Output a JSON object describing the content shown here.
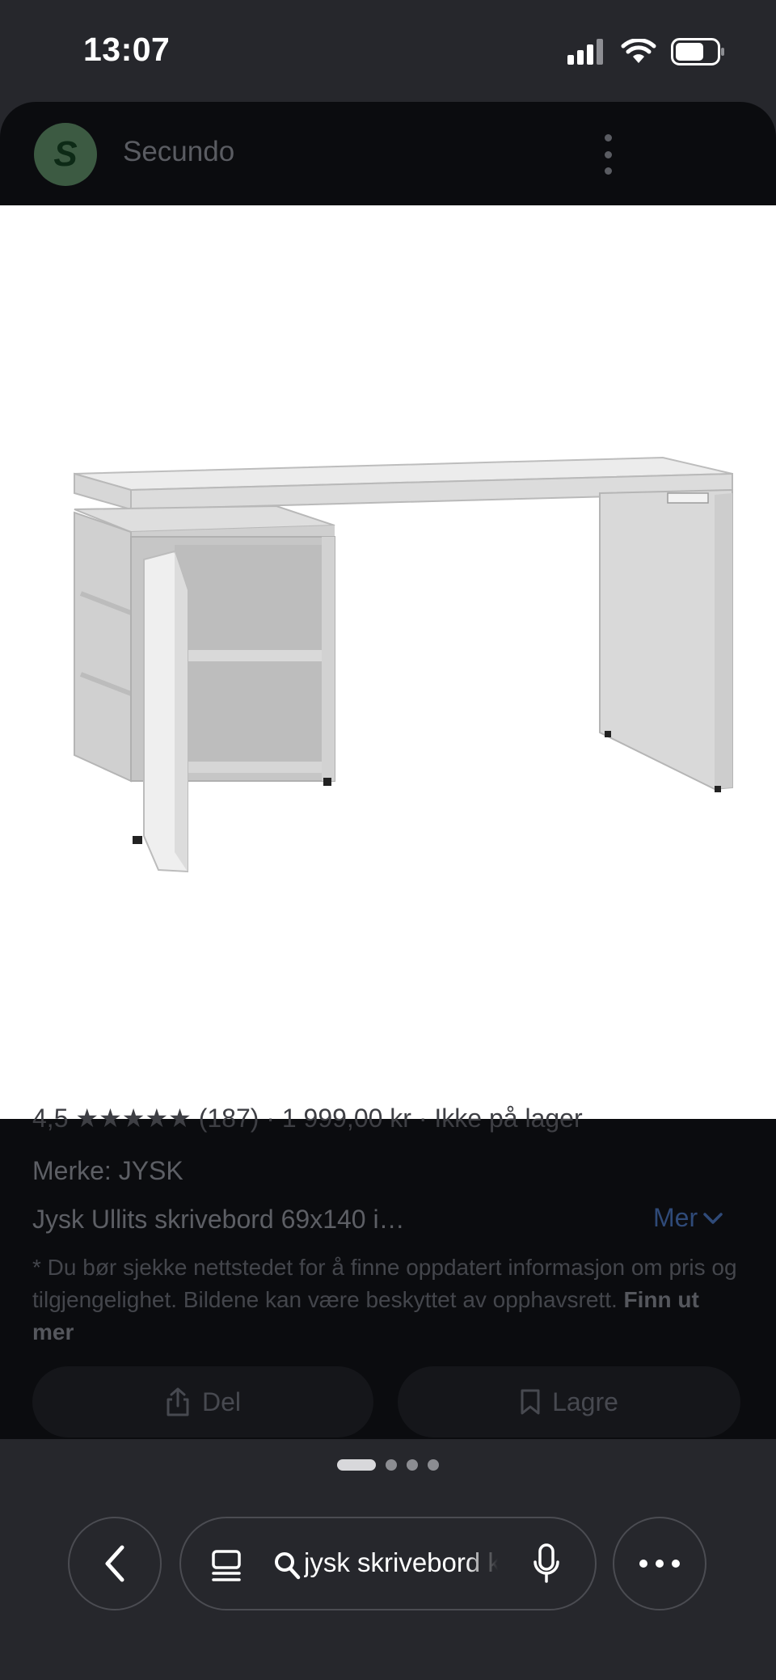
{
  "status": {
    "time": "13:07"
  },
  "site": {
    "logo_letter": "S",
    "name": "Secundo"
  },
  "product": {
    "rating_text": "4,5 ★★★★★ (187) · 1 999,00 kr · Ikke på lager",
    "brand": "Merke: JYSK",
    "title": "Jysk Ullits skrivebord 69x140 i…",
    "more_label": "Mer",
    "disclaimer": "* Du bør sjekke nettstedet for å finne oppdatert informasjon om pris og tilgjengelighet. Bildene kan være beskyttet av opphavsrett.",
    "learn_more": "Finn ut mer"
  },
  "actions": {
    "share_label": "Del",
    "save_label": "Lagre"
  },
  "browser": {
    "url_text": "jysk skrivebord k"
  },
  "colors": {
    "background": "#26272c",
    "sheet": "#0b0c0f",
    "link": "#2f4a78"
  },
  "icons": [
    "signal-icon",
    "wifi-icon",
    "battery-icon",
    "kebab-menu-icon",
    "share-icon",
    "bookmark-icon",
    "chevron-left-icon",
    "tabs-icon",
    "search-icon",
    "mic-icon",
    "ellipsis-icon",
    "chevron-down-icon"
  ]
}
